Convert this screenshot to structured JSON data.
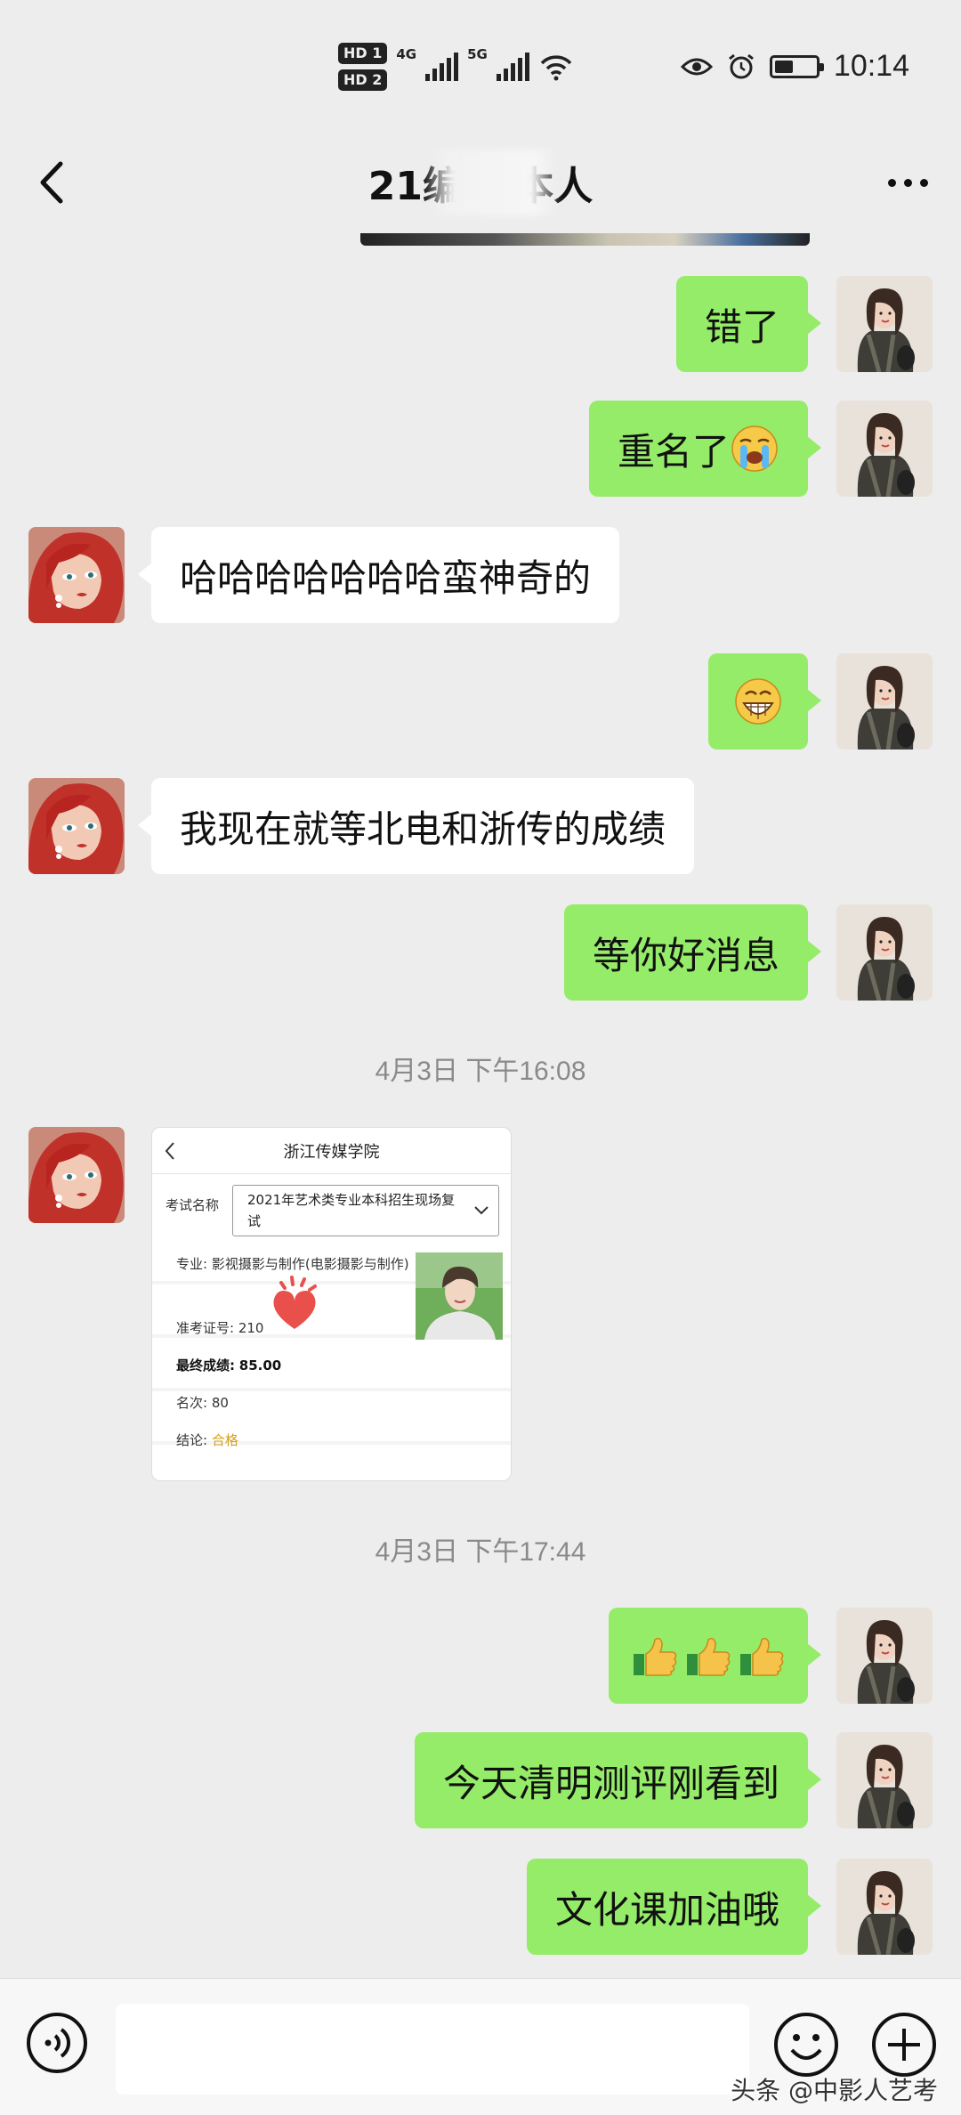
{
  "status_bar": {
    "sim1": "HD 1",
    "sim2": "HD 2",
    "net1": "4G",
    "net2": "5G",
    "time": "10:14"
  },
  "header": {
    "title": "21编导          本人"
  },
  "messages": [
    {
      "side": "me",
      "text": "错了"
    },
    {
      "side": "me",
      "text": "重名了",
      "emoji": "crying-face-icon"
    },
    {
      "side": "them",
      "text": "哈哈哈哈哈哈哈蛮神奇的"
    },
    {
      "side": "me",
      "text": "",
      "emoji": "grinning-face-icon"
    },
    {
      "side": "them",
      "text": "我现在就等北电和浙传的成绩"
    },
    {
      "side": "me",
      "text": "等你好消息"
    },
    {
      "timestamp": "4月3日 下午16:08"
    },
    {
      "side": "them",
      "type": "image"
    },
    {
      "timestamp": "4月3日 下午17:44"
    },
    {
      "side": "me",
      "text": "",
      "emoji": "thumbs-up-icon x3"
    },
    {
      "side": "me",
      "text": "今天清明测评刚看到"
    },
    {
      "side": "me",
      "text": "文化课加油哦"
    }
  ],
  "image_message": {
    "title": "浙江传媒学院",
    "exam_label": "考试名称",
    "exam_value": "2021年艺术类专业本科招生现场复试",
    "major_label": "专业:",
    "major_value": "影视摄影与制作(电影摄影与制作)",
    "ticket_label": "准考证号:",
    "ticket_value": "210",
    "score_label": "最终成绩:",
    "score_value": "85.00",
    "rank_label": "名次:",
    "rank_value": "80",
    "conclusion_label": "结论:",
    "conclusion_value": "合格"
  },
  "input_bar": {
    "watermark": "头条 @中影人艺考"
  },
  "colors": {
    "background": "#ededed",
    "my_bubble": "#95ec69",
    "their_bubble": "#ffffff",
    "timestamp": "#8a8a8a",
    "pass": "#d4a017"
  }
}
